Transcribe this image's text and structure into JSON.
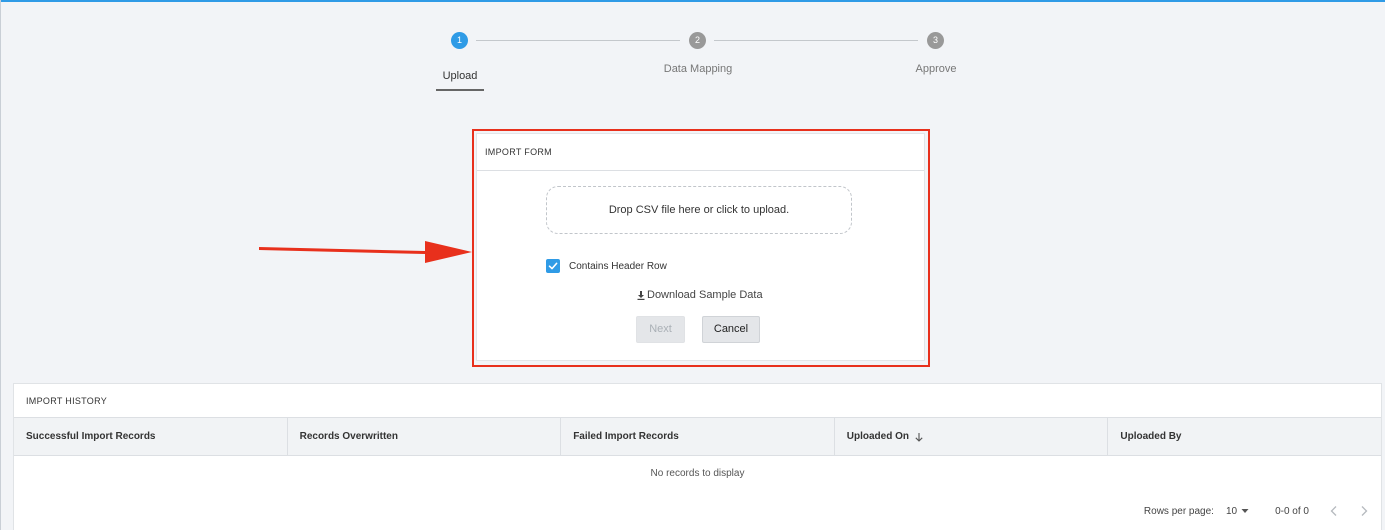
{
  "stepper": {
    "steps": [
      {
        "number": "1",
        "label": "Upload",
        "active": true
      },
      {
        "number": "2",
        "label": "Data Mapping",
        "active": false
      },
      {
        "number": "3",
        "label": "Approve",
        "active": false
      }
    ]
  },
  "import_form": {
    "title": "IMPORT FORM",
    "dropzone_text": "Drop CSV file here or click to upload.",
    "header_row_label": "Contains Header Row",
    "header_row_checked": true,
    "download_label": "Download Sample Data",
    "next_label": "Next",
    "cancel_label": "Cancel"
  },
  "import_history": {
    "title": "IMPORT HISTORY",
    "columns": [
      "Successful Import Records",
      "Records Overwritten",
      "Failed Import Records",
      "Uploaded On",
      "Uploaded By"
    ],
    "empty_text": "No records to display",
    "rows_per_page_label": "Rows per page:",
    "rows_per_page_value": "10",
    "range_text": "0-0 of 0"
  },
  "colors": {
    "accent": "#2f9be6",
    "highlight": "#e8301c",
    "background": "#f2f4f7"
  },
  "icons": [
    "check-icon",
    "download-icon",
    "sort-down-icon",
    "caret-down-icon",
    "chevron-left-icon",
    "chevron-right-icon"
  ]
}
